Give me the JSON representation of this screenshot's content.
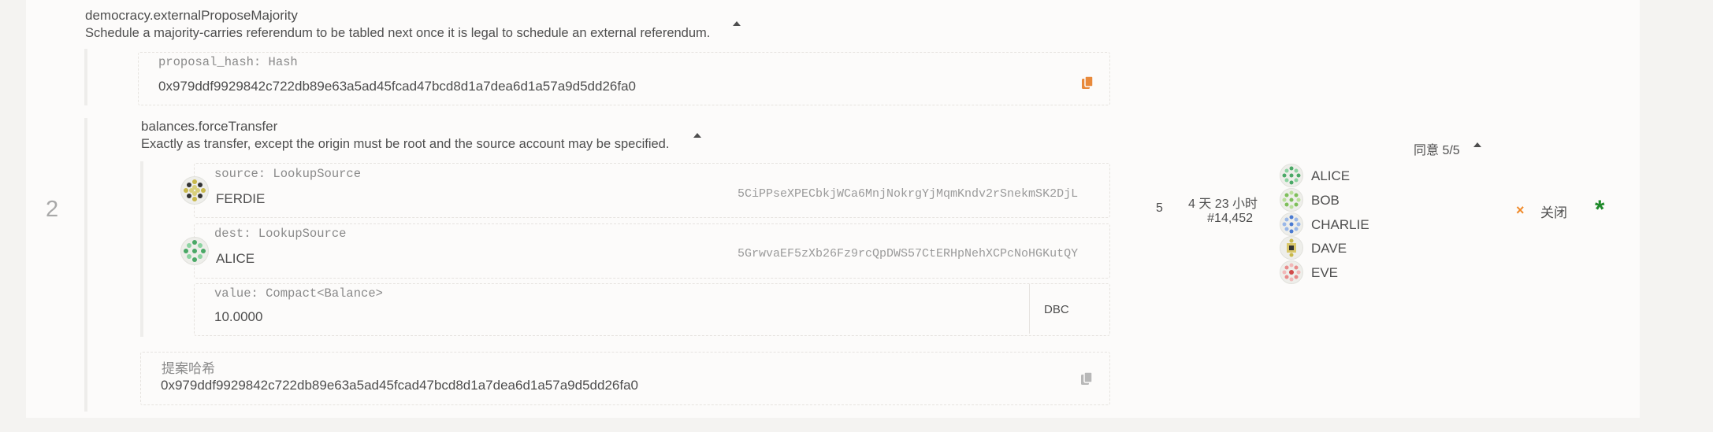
{
  "colors": {
    "page_bg": "#f4f3f1",
    "card_bg": "#fcfbfa",
    "text": "#4e4e4e",
    "muted": "#8a8a8a",
    "copy_icon_orange": "#e8893a",
    "close_x_orange": "#f08a2a",
    "green_asterisk": "#1f8a2a"
  },
  "first_call": {
    "title": "democracy.externalProposeMajority",
    "description": "Schedule a majority-carries referendum to be tabled next once it is legal to schedule an external referendum.",
    "param": {
      "label": "proposal_hash: Hash",
      "value": "0x979ddf9929842c722db89e63a5ad45fcad47bcd8d1a7dea6d1a57a9d5dd26fa0",
      "icon": "copy-icon"
    }
  },
  "row": {
    "index": "2",
    "threshold": "5",
    "time_remaining": "4 天 23 小时",
    "block": "#14,452",
    "votes_summary": "同意 5/5",
    "voters": [
      "ALICE",
      "BOB",
      "CHARLIE",
      "DAVE",
      "EVE"
    ],
    "close_label": "关闭",
    "close_icon": "x-icon",
    "status_icon": "asterisk-icon"
  },
  "second_call": {
    "title": "balances.forceTransfer",
    "description": "Exactly as transfer, except the origin must be root and the source account may be specified.",
    "source": {
      "label": "source: LookupSource",
      "name": "FERDIE",
      "address": "5CiPPseXPECbkjWCa6MnjNokrgYjMqmKndv2rSnekmSK2DjL"
    },
    "dest": {
      "label": "dest: LookupSource",
      "name": "ALICE",
      "address": "5GrwvaEF5zXb26Fz9rcQpDWS57CtERHpNehXCPcNoHGKutQY"
    },
    "value": {
      "label": "value: Compact<Balance>",
      "amount": "10.0000",
      "unit": "DBC"
    }
  },
  "proposal_hash": {
    "label": "提案哈希",
    "value": "0x979ddf9929842c722db89e63a5ad45fcad47bcd8d1a7dea6d1a57a9d5dd26fa0",
    "icon": "copy-icon"
  }
}
